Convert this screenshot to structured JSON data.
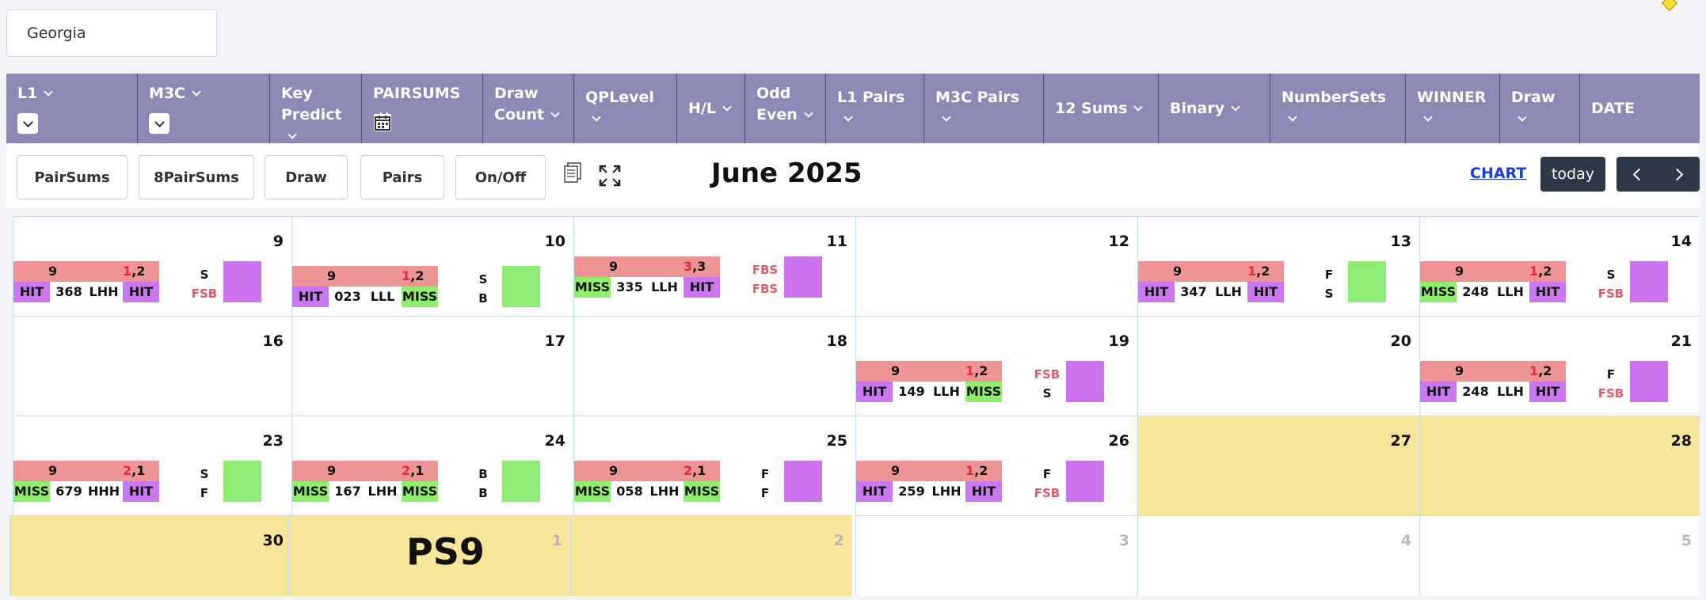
{
  "state": {
    "value": "Georgia"
  },
  "columns": [
    {
      "line1": "L1",
      "line2": "",
      "chev": true,
      "filter": true,
      "width": 166
    },
    {
      "line1": "M3C",
      "line2": "",
      "chev": true,
      "filter": true,
      "width": 167
    },
    {
      "line1": "Key",
      "line2": "Predict",
      "chev": true,
      "width": 116
    },
    {
      "line1": "PAIRSUMS",
      "line2": "",
      "chev": true,
      "calendar": true,
      "width": 153
    },
    {
      "line1": "Draw",
      "line2": "Count",
      "chev": true,
      "width": 115
    },
    {
      "line1": "QPLevel",
      "line2": "",
      "chev": true,
      "center": true,
      "width": 130
    },
    {
      "line1": "H/L",
      "line2": "",
      "chev": true,
      "center": true,
      "width": 86
    },
    {
      "line1": "Odd",
      "line2": "Even",
      "chev": true,
      "width": 102
    },
    {
      "line1": "L1 Pairs",
      "line2": "",
      "chev": true,
      "center": true,
      "width": 124
    },
    {
      "line1": "M3C Pairs",
      "line2": "",
      "chev": true,
      "center": true,
      "width": 151
    },
    {
      "line1": "12 Sums",
      "line2": "",
      "chev": true,
      "center": true,
      "width": 145
    },
    {
      "line1": "Binary",
      "line2": "",
      "chev": true,
      "center": true,
      "width": 141
    },
    {
      "line1": "NumberSets",
      "line2": "",
      "chev": true,
      "center": true,
      "width": 171
    },
    {
      "line1": "WINNER",
      "line2": "",
      "chev": true,
      "center": true,
      "width": 119
    },
    {
      "line1": "Draw",
      "line2": "",
      "chev": true,
      "center": true,
      "width": 101
    },
    {
      "line1": "DATE",
      "line2": "",
      "chev": false,
      "center": true,
      "width": 151
    }
  ],
  "toolbar": {
    "buttons": [
      "PairSums",
      "8PairSums",
      "Draw",
      "Pairs",
      "On/Off"
    ],
    "month_title": "June 2025",
    "chart_link": "CHART",
    "today": "today",
    "icons": [
      "copy-icon",
      "expand-icon"
    ]
  },
  "calendar": {
    "weeks": [
      [
        {
          "day": "9",
          "ev": {
            "a": "9",
            "b1": "1",
            "b2": ",2",
            "l1": "HIT",
            "num": "368",
            "hl": "LHH",
            "r1": "HIT",
            "s1": "S",
            "s1red": false,
            "s2": "FSB",
            "s2red": true,
            "sq": "purple"
          }
        },
        {
          "day": "10",
          "ev": {
            "a": "9",
            "b1": "1",
            "b2": ",2",
            "l1": "HIT",
            "num": "023",
            "hl": "LLL",
            "r1": "MISS",
            "s1": "S",
            "s1red": false,
            "s2": "B",
            "s2red": false,
            "sq": "green",
            "shift": 6
          }
        },
        {
          "day": "11",
          "ev": {
            "a": "9",
            "b1": "3",
            "b2": ",3",
            "l1": "MISS",
            "num": "335",
            "hl": "LLH",
            "r1": "HIT",
            "s1": "FBS",
            "s1red": true,
            "s2": "FBS",
            "s2red": true,
            "sq": "purple",
            "shift": -6
          }
        },
        {
          "day": "12"
        },
        {
          "day": "13",
          "ev": {
            "a": "9",
            "b1": "1",
            "b2": ",2",
            "l1": "HIT",
            "num": "347",
            "hl": "LLH",
            "r1": "HIT",
            "s1": "F",
            "s1red": false,
            "s2": "S",
            "s2red": false,
            "sq": "green"
          }
        },
        {
          "day": "14",
          "ev": {
            "a": "9",
            "b1": "1",
            "b2": ",2",
            "l1": "MISS",
            "num": "248",
            "hl": "LLH",
            "r1": "HIT",
            "s1": "S",
            "s1red": false,
            "s2": "FSB",
            "s2red": true,
            "sq": "purple"
          }
        }
      ],
      [
        {
          "day": "16"
        },
        {
          "day": "17"
        },
        {
          "day": "18"
        },
        {
          "day": "19",
          "ev": {
            "a": "9",
            "b1": "1",
            "b2": ",2",
            "l1": "HIT",
            "num": "149",
            "hl": "LLH",
            "r1": "MISS",
            "s1": "FSB",
            "s1red": true,
            "s2": "S",
            "s2red": false,
            "sq": "purple"
          }
        },
        {
          "day": "20"
        },
        {
          "day": "21",
          "ev": {
            "a": "9",
            "b1": "1",
            "b2": ",2",
            "l1": "HIT",
            "num": "248",
            "hl": "LLH",
            "r1": "HIT",
            "s1": "F",
            "s1red": false,
            "s2": "FSB",
            "s2red": true,
            "sq": "purple"
          }
        }
      ],
      [
        {
          "day": "23",
          "ev": {
            "a": "9",
            "b1": "2",
            "b2": ",1",
            "l1": "MISS",
            "num": "679",
            "hl": "HHH",
            "r1": "HIT",
            "s1": "S",
            "s1red": false,
            "s2": "F",
            "s2red": false,
            "sq": "green"
          }
        },
        {
          "day": "24",
          "ev": {
            "a": "9",
            "b1": "2",
            "b2": ",1",
            "l1": "MISS",
            "num": "167",
            "hl": "LHH",
            "r1": "MISS",
            "s1": "B",
            "s1red": false,
            "s2": "B",
            "s2red": false,
            "sq": "green"
          }
        },
        {
          "day": "25",
          "ev": {
            "a": "9",
            "b1": "2",
            "b2": ",1",
            "l1": "MISS",
            "num": "058",
            "hl": "LHH",
            "r1": "MISS",
            "s1": "F",
            "s1red": false,
            "s2": "F",
            "s2red": false,
            "sq": "purple"
          }
        },
        {
          "day": "26",
          "ev": {
            "a": "9",
            "b1": "1",
            "b2": ",2",
            "l1": "HIT",
            "num": "259",
            "hl": "LHH",
            "r1": "HIT",
            "s1": "F",
            "s1red": false,
            "s2": "FSB",
            "s2red": true,
            "sq": "purple"
          }
        },
        {
          "day": "27",
          "yellow": true
        },
        {
          "day": "28",
          "yellow": true
        }
      ],
      [
        {
          "day": "30",
          "yellow": true
        },
        {
          "day": "1",
          "yellow": true,
          "other": true,
          "label": "PS9"
        },
        {
          "day": "2",
          "yellow": true,
          "other": true
        },
        {
          "day": "3",
          "other": true
        },
        {
          "day": "4",
          "other": true
        },
        {
          "day": "5",
          "other": true
        }
      ]
    ]
  }
}
